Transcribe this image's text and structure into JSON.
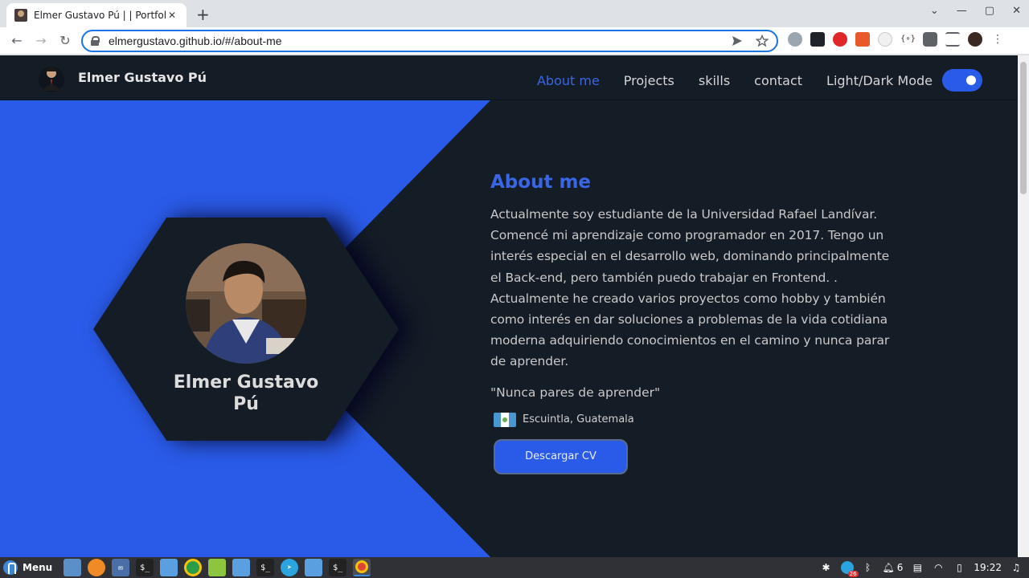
{
  "browser": {
    "tab_title": "Elmer Gustavo Pú | | Portfolio",
    "tab_close": "✕",
    "new_tab": "+",
    "url": "elmergustavo.github.io/#/about-me",
    "nav": {
      "back": "←",
      "forward": "→",
      "reload": "↻"
    },
    "window_controls": {
      "minimize": "—",
      "maximize": "▢",
      "close": "✕",
      "dropdown": "⌄"
    }
  },
  "navbar": {
    "brand_name": "Elmer Gustavo Pú",
    "links": [
      "About me",
      "Projects",
      "skills",
      "contact"
    ],
    "mode_label": "Light/Dark Mode",
    "dark_mode_on": true
  },
  "profile": {
    "name": "Elmer Gustavo Pú"
  },
  "about": {
    "title": "About me",
    "text": "Actualmente soy estudiante de la Universidad Rafael Landívar. Comencé mi aprendizaje como programador en 2017. Tengo un interés especial en el desarrollo web, dominando principalmente el Back-end, pero también puedo trabajar en Frontend. . Actualmente he creado varios proyectos como hobby y también como interés en dar soluciones a problemas de la vida cotidiana moderna adquiriendo conocimientos en el camino y nunca parar de aprender.",
    "quote": "\"Nunca pares de aprender\"",
    "location": "Escuintla, Guatemala",
    "cv_button": "Descargar CV"
  },
  "taskbar": {
    "menu_label": "Menu",
    "tray_count": "6",
    "clock": "19:22",
    "badge": "26"
  },
  "colors": {
    "accent": "#2a5be8",
    "page_bg": "#141c26",
    "link_active": "#3a66e6"
  }
}
